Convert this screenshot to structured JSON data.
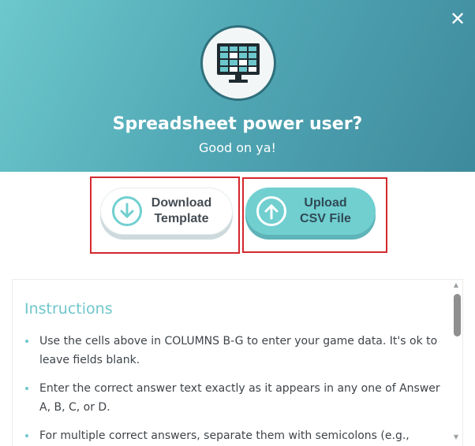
{
  "header": {
    "title": "Spreadsheet power user?",
    "subtitle": "Good on ya!",
    "logo_icon": "spreadsheet-monitor-icon",
    "close_icon": "close-icon",
    "accent_color": "#71cfd0"
  },
  "buttons": {
    "download_label": "Download\nTemplate",
    "download_icon": "download-arrow-icon",
    "upload_label": "Upload\nCSV File",
    "upload_icon": "upload-arrow-icon",
    "highlight_color": "#d3282d"
  },
  "instructions": {
    "title": "Instructions",
    "items": [
      "Use the cells above in COLUMNS B-G to enter your game data. It's ok to leave fields blank.",
      "Enter the correct answer text exactly as it appears in any one of Answer A, B, C, or D.",
      "For multiple correct answers, separate them with semicolons (e.g.,"
    ]
  }
}
